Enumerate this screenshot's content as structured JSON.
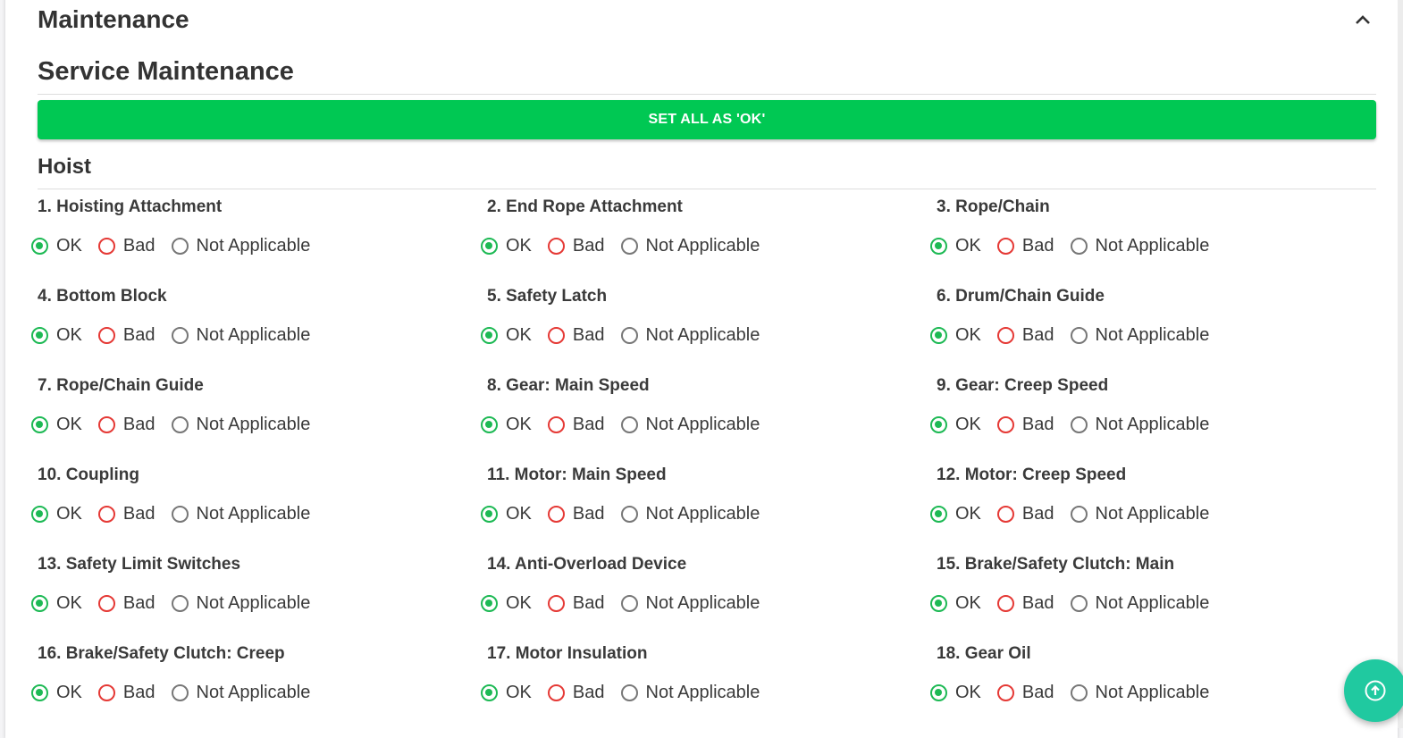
{
  "section": {
    "title": "Maintenance",
    "collapse_icon": "chevron-up-icon"
  },
  "subsection": {
    "title": "Service Maintenance",
    "set_all_label": "SET ALL AS 'OK'"
  },
  "group": {
    "title": "Hoist",
    "options": [
      "OK",
      "Bad",
      "Not Applicable"
    ],
    "items": [
      {
        "label": "1. Hoisting Attachment",
        "selected": "OK"
      },
      {
        "label": "2. End Rope Attachment",
        "selected": "OK"
      },
      {
        "label": "3. Rope/Chain",
        "selected": "OK"
      },
      {
        "label": "4. Bottom Block",
        "selected": "OK"
      },
      {
        "label": "5. Safety Latch",
        "selected": "OK"
      },
      {
        "label": "6. Drum/Chain Guide",
        "selected": "OK"
      },
      {
        "label": "7. Rope/Chain Guide",
        "selected": "OK"
      },
      {
        "label": "8. Gear: Main Speed",
        "selected": "OK"
      },
      {
        "label": "9. Gear: Creep Speed",
        "selected": "OK"
      },
      {
        "label": "10. Coupling",
        "selected": "OK"
      },
      {
        "label": "11. Motor: Main Speed",
        "selected": "OK"
      },
      {
        "label": "12. Motor: Creep Speed",
        "selected": "OK"
      },
      {
        "label": "13. Safety Limit Switches",
        "selected": "OK"
      },
      {
        "label": "14. Anti-Overload Device",
        "selected": "OK"
      },
      {
        "label": "15. Brake/Safety Clutch: Main",
        "selected": "OK"
      },
      {
        "label": "16. Brake/Safety Clutch: Creep",
        "selected": "OK"
      },
      {
        "label": "17. Motor Insulation",
        "selected": "OK"
      },
      {
        "label": "18. Gear Oil",
        "selected": "OK"
      }
    ]
  },
  "fab": {
    "icon": "arrow-circle-up-icon"
  },
  "colors": {
    "accent_green": "#00c853",
    "ok_radio": "#1db954",
    "bad_radio": "#e53935",
    "na_radio": "#777777",
    "fab": "#20c9a0"
  }
}
